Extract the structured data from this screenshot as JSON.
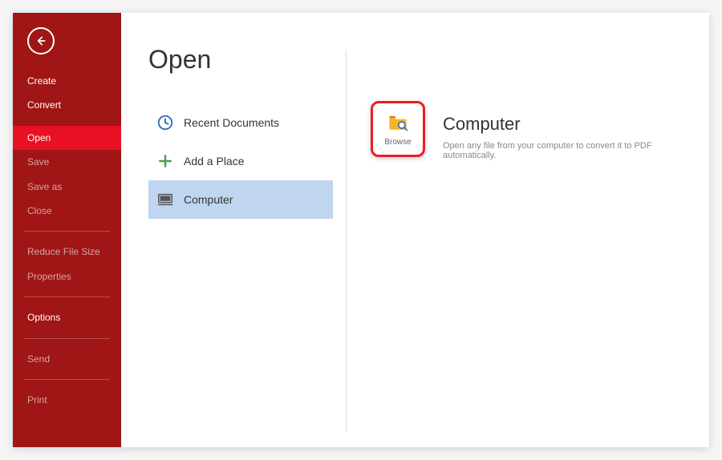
{
  "page": {
    "title": "Open"
  },
  "sidebar": {
    "items": [
      {
        "label": "Create",
        "state": "normal"
      },
      {
        "label": "Convert",
        "state": "normal"
      },
      {
        "label": "Open",
        "state": "active"
      },
      {
        "label": "Save",
        "state": "disabled"
      },
      {
        "label": "Save as",
        "state": "disabled"
      },
      {
        "label": "Close",
        "state": "disabled"
      },
      {
        "label": "Reduce File Size",
        "state": "disabled"
      },
      {
        "label": "Properties",
        "state": "disabled"
      },
      {
        "label": "Options",
        "state": "normal"
      },
      {
        "label": "Send",
        "state": "disabled"
      },
      {
        "label": "Print",
        "state": "disabled"
      }
    ]
  },
  "locations": {
    "recent": {
      "label": "Recent Documents"
    },
    "add": {
      "label": "Add a Place"
    },
    "computer": {
      "label": "Computer"
    }
  },
  "browse": {
    "label": "Browse"
  },
  "detail": {
    "title": "Computer",
    "desc": "Open any file from your computer to convert it to PDF automatically."
  },
  "colors": {
    "brand": "#a01515",
    "accent": "#e81123",
    "highlight": "#eb1c24",
    "selection": "#c0d6f0"
  }
}
